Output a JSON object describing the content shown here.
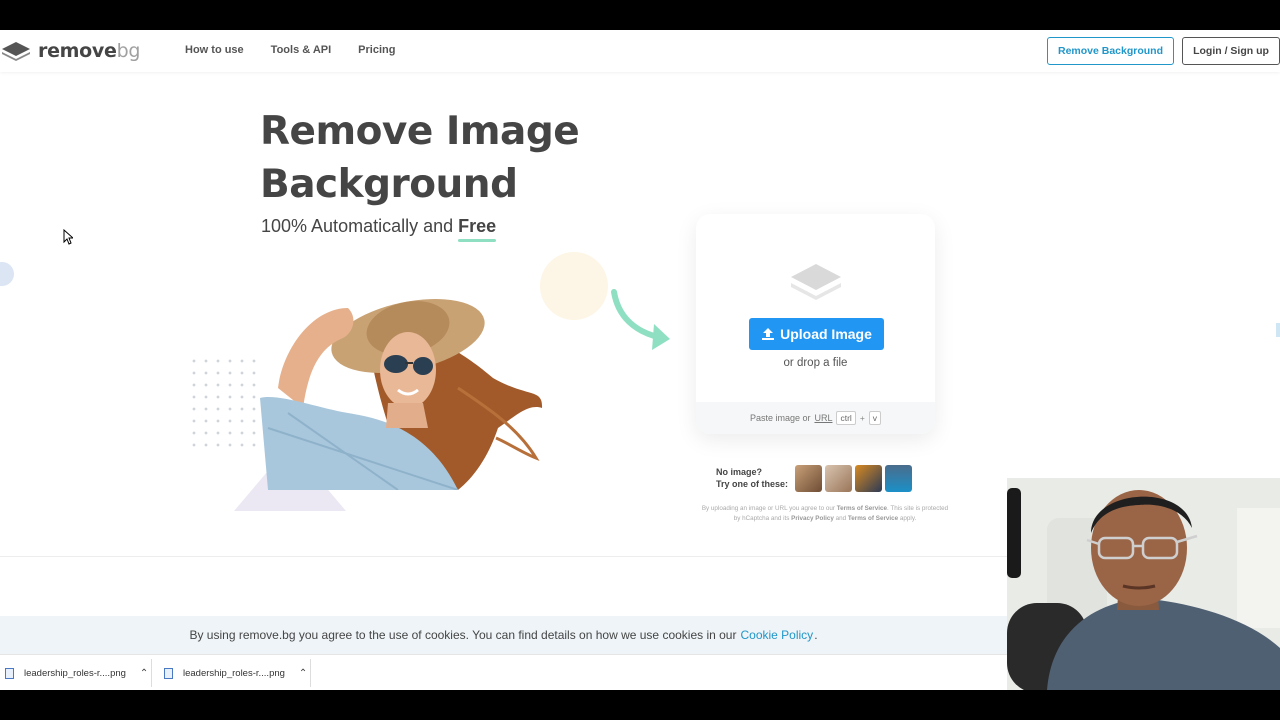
{
  "header": {
    "logo_text_main": "remove",
    "logo_text_bg": "bg",
    "nav": [
      "How to use",
      "Tools & API",
      "Pricing"
    ],
    "remove_background_button": "Remove Background",
    "login_button": "Login / Sign up"
  },
  "hero": {
    "title_line1": "Remove Image",
    "title_line2": "Background",
    "subtitle_prefix": "100% Automatically and",
    "subtitle_emphasis": "Free"
  },
  "upload": {
    "button_label": "Upload Image",
    "drop_text": "or drop a file",
    "paste_prefix": "Paste image or",
    "paste_url": "URL",
    "shortcut_ctrl": "ctrl",
    "shortcut_plus": "+",
    "shortcut_v": "v"
  },
  "samples": {
    "label_line1": "No image?",
    "label_line2": "Try one of these:"
  },
  "terms": {
    "part1": "By uploading an image or URL you agree to our",
    "tos": "Terms of Service",
    "part2": ". This site is protected by hCaptcha and its",
    "privacy": "Privacy Policy",
    "and": "and",
    "tos2": "Terms of Service",
    "part3": "apply."
  },
  "cookie": {
    "text": "By using remove.bg you agree to the use of cookies. You can find details on how we use cookies in our",
    "link": "Cookie Policy",
    "end": "."
  },
  "downloads": [
    {
      "filename": "leadership_roles-r....png"
    },
    {
      "filename": "leadership_roles-r....png"
    }
  ],
  "colors": {
    "accent_blue": "#2196f3",
    "link_blue": "#2196c9",
    "text_dark": "#454545",
    "underline_green": "#8fe0c3"
  }
}
